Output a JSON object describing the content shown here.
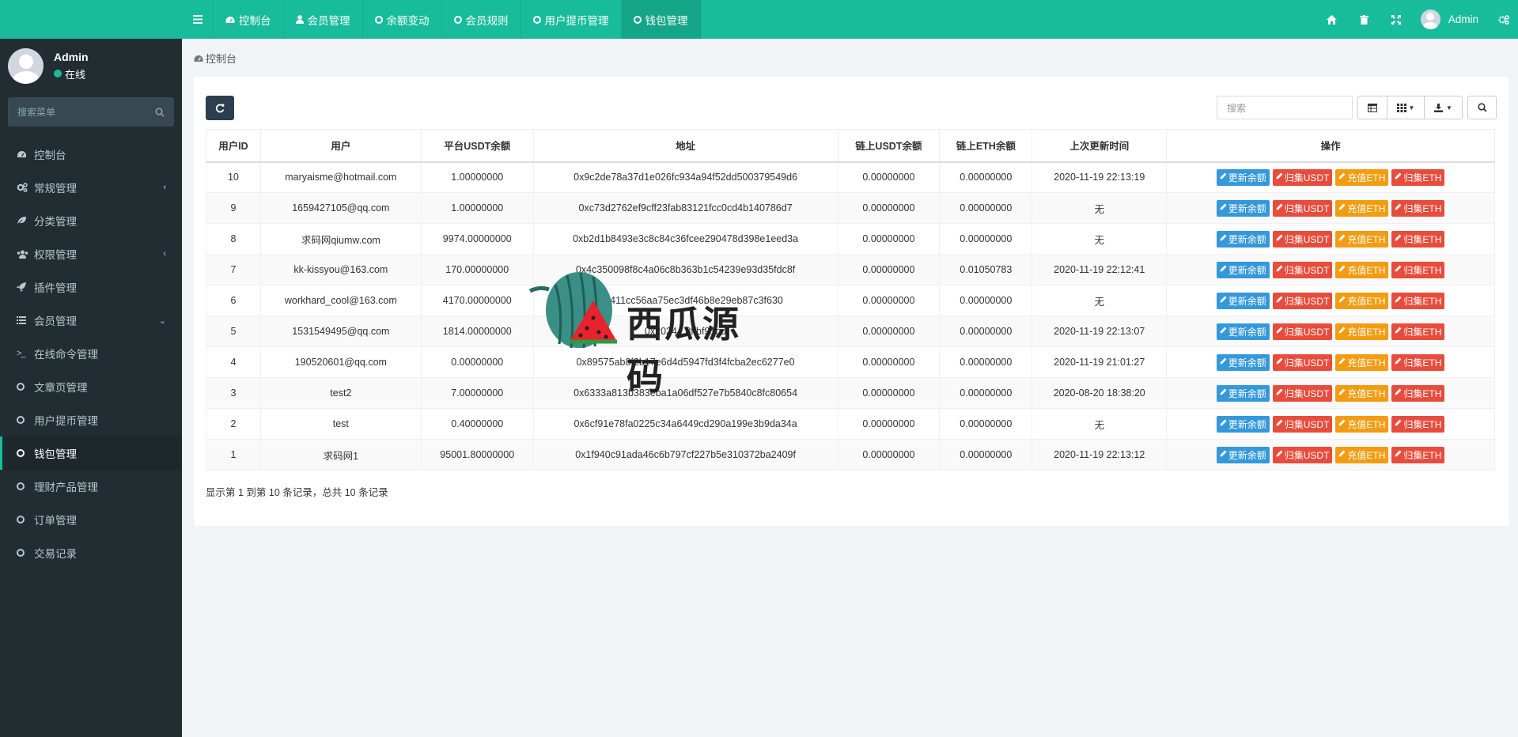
{
  "sidebar": {
    "user": {
      "name": "Admin",
      "status": "在线"
    },
    "search_placeholder": "搜索菜单",
    "items": [
      {
        "label": "控制台",
        "icon": "dashboard-icon"
      },
      {
        "label": "常规管理",
        "icon": "cogs-icon",
        "arrow": "‹"
      },
      {
        "label": "分类管理",
        "icon": "leaf-icon"
      },
      {
        "label": "权限管理",
        "icon": "group-icon",
        "arrow": "‹"
      },
      {
        "label": "插件管理",
        "icon": "rocket-icon"
      },
      {
        "label": "会员管理",
        "icon": "list-icon",
        "arrow": "⌄"
      },
      {
        "label": "在线命令管理",
        "icon": "terminal-icon"
      },
      {
        "label": "文章页管理",
        "icon": "circle-icon"
      },
      {
        "label": "用户提币管理",
        "icon": "circle-icon"
      },
      {
        "label": "钱包管理",
        "icon": "circle-icon",
        "active": true
      },
      {
        "label": "理财产品管理",
        "icon": "circle-icon"
      },
      {
        "label": "订单管理",
        "icon": "circle-icon"
      },
      {
        "label": "交易记录",
        "icon": "circle-icon"
      }
    ]
  },
  "topnav": {
    "tabs": [
      {
        "label": "控制台"
      },
      {
        "label": "会员管理"
      },
      {
        "label": "余额变动"
      },
      {
        "label": "会员规则"
      },
      {
        "label": "用户提币管理"
      },
      {
        "label": "钱包管理",
        "active": true
      }
    ],
    "user_name": "Admin"
  },
  "breadcrumb": "控制台",
  "toolbar": {
    "search_placeholder": "搜索"
  },
  "table": {
    "headers": [
      "用户ID",
      "用户",
      "平台USDT余额",
      "地址",
      "链上USDT余额",
      "链上ETH余额",
      "上次更新时间",
      "操作"
    ],
    "rows": [
      [
        "10",
        "maryaisme@hotmail.com",
        "1.00000000",
        "0x9c2de78a37d1e026fc934a94f52dd500379549d6",
        "0.00000000",
        "0.00000000",
        "2020-11-19 22:13:19"
      ],
      [
        "9",
        "1659427105@qq.com",
        "1.00000000",
        "0xc73d2762ef9cff23fab83121fcc0cd4b140786d7",
        "0.00000000",
        "0.00000000",
        "无"
      ],
      [
        "8",
        "求码网qiumw.com",
        "9974.00000000",
        "0xb2d1b8493e3c8c84c36fcee290478d398e1eed3a",
        "0.00000000",
        "0.00000000",
        "无"
      ],
      [
        "7",
        "kk-kissyou@163.com",
        "170.00000000",
        "0x4c350098f8c4a06c8b363b1c54239e93d35fdc8f",
        "0.00000000",
        "0.01050783",
        "2020-11-19 22:12:41"
      ],
      [
        "6",
        "workhard_cool@163.com",
        "4170.00000000",
        "7e37411cc56aa75ec3df46b8e29eb87c3f630",
        "0.00000000",
        "0.00000000",
        "无"
      ],
      [
        "5",
        "1531549495@qq.com",
        "1814.00000000",
        "0x2024...8ffbf91bd",
        "0.00000000",
        "0.00000000",
        "2020-11-19 22:13:07"
      ],
      [
        "4",
        "190520601@qq.com",
        "0.00000000",
        "0x89575ab8f2b17e6d4d5947fd3f4fcba2ec6277e0",
        "0.00000000",
        "0.00000000",
        "2020-11-19 21:01:27"
      ],
      [
        "3",
        "test2",
        "7.00000000",
        "0x6333a813b383eba1a06df527e7b5840c8fc80654",
        "0.00000000",
        "0.00000000",
        "2020-08-20 18:38:20"
      ],
      [
        "2",
        "test",
        "0.40000000",
        "0x6cf91e78fa0225c34a6449cd290a199e3b9da34a",
        "0.00000000",
        "0.00000000",
        "无"
      ],
      [
        "1",
        "求码网1",
        "95001.80000000",
        "0x1f940c91ada46c6b797cf227b5e310372ba2409f",
        "0.00000000",
        "0.00000000",
        "2020-11-19 22:13:12"
      ]
    ],
    "ops": [
      {
        "label": "更新余额",
        "color": "#3498db"
      },
      {
        "label": "归集USDT",
        "color": "#e74c3c"
      },
      {
        "label": "充值ETH",
        "color": "#f39c12"
      },
      {
        "label": "归集ETH",
        "color": "#e74c3c"
      }
    ]
  },
  "footer": "显示第 1 到第 10 条记录，总共 10 条记录",
  "watermark": "西瓜源码",
  "colors": {
    "primary": "#18bc9c",
    "sidebar": "#222d32",
    "dark_btn": "#2c3e50"
  }
}
